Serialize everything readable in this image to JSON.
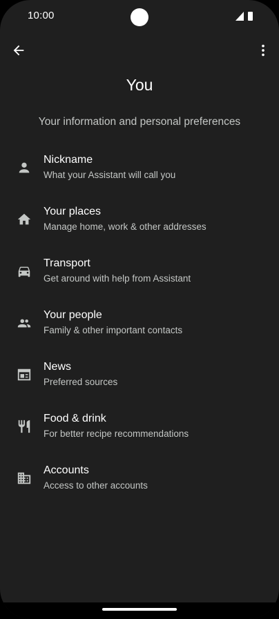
{
  "status_bar": {
    "time": "10:00"
  },
  "top_bar": {
    "back_icon": "arrow-back-icon",
    "more_icon": "more-vert-icon"
  },
  "page": {
    "title": "You",
    "subtitle": "Your information and personal preferences"
  },
  "items": [
    {
      "icon": "person-icon",
      "title": "Nickname",
      "subtitle": "What your Assistant will call you"
    },
    {
      "icon": "home-icon",
      "title": "Your places",
      "subtitle": "Manage home, work & other addresses"
    },
    {
      "icon": "car-icon",
      "title": "Transport",
      "subtitle": "Get around with help from Assistant"
    },
    {
      "icon": "people-icon",
      "title": "Your people",
      "subtitle": "Family & other important contacts"
    },
    {
      "icon": "newspaper-icon",
      "title": "News",
      "subtitle": "Preferred sources"
    },
    {
      "icon": "restaurant-icon",
      "title": "Food & drink",
      "subtitle": "For better recipe recommendations"
    },
    {
      "icon": "building-icon",
      "title": "Accounts",
      "subtitle": "Access to other accounts"
    }
  ],
  "colors": {
    "background": "#1f1f1f",
    "primary_text": "#ffffff",
    "secondary_text": "#c4c7c5",
    "icon": "#c4c7c5"
  }
}
